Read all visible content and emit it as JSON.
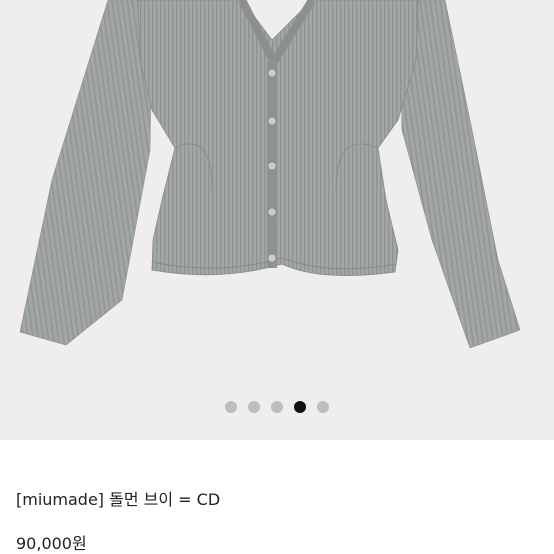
{
  "product": {
    "title": "[miumade] 돌먼 브이 = CD",
    "price": "90,000원"
  },
  "gallery": {
    "image_count": 5,
    "active_index": 3,
    "image_subject": "gray ribbed v-neck knit cardigan",
    "colors": {
      "background": "#efeeec",
      "garment": "#a0a4a3",
      "dot_inactive": "#bdbdbd",
      "dot_active": "#111111"
    }
  }
}
